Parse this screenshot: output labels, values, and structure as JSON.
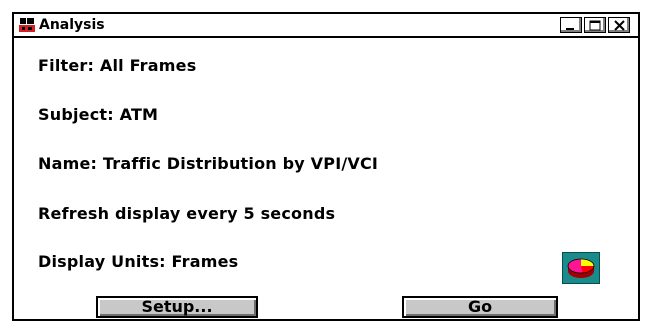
{
  "window": {
    "title": "Analysis",
    "app_icon": "network-analyzer-icon",
    "controls": [
      "minimize-icon",
      "maximize-icon",
      "close-icon"
    ]
  },
  "fields": {
    "filter": "Filter: All Frames",
    "subject": "Subject: ATM",
    "name": "Name: Traffic Distribution by VPI/VCI",
    "refresh": "Refresh display every 5 seconds",
    "units": "Display Units: Frames"
  },
  "chart_button": {
    "icon": "pie-chart-icon",
    "colors": [
      "#ff1493",
      "#ffff00",
      "#ff0000",
      "#1a8b8b"
    ]
  },
  "buttons": {
    "setup": "Setup...",
    "go": "Go"
  }
}
